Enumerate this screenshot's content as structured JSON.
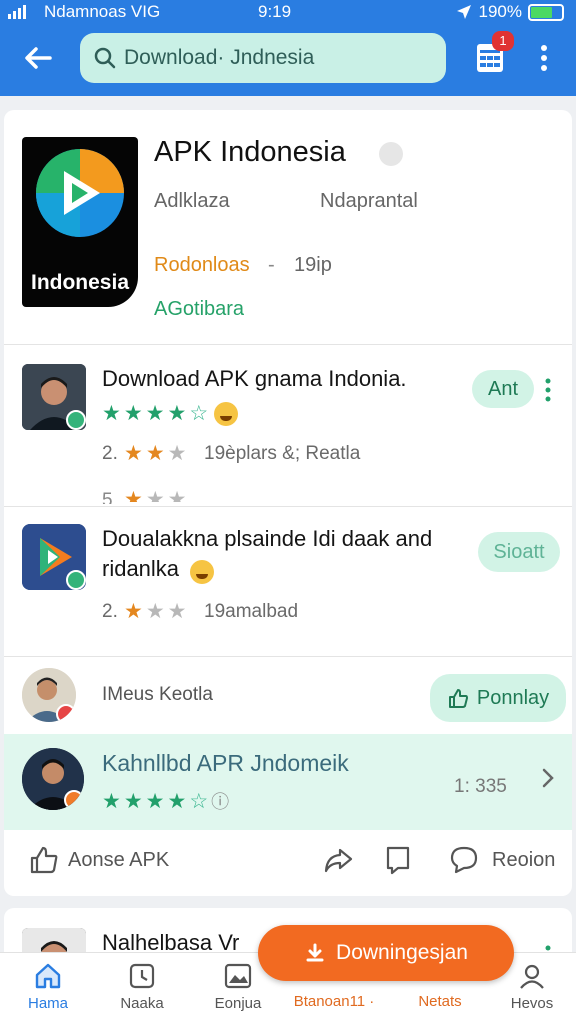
{
  "status_bar": {
    "carrier": "Ndamnoas VIG",
    "time": "9:19",
    "battery": "190%"
  },
  "search": {
    "value": "Download· Jndnesia",
    "placeholder": "Download· Jndnesia"
  },
  "header": {
    "notification_count": "1"
  },
  "app": {
    "title": "APK Indonesia",
    "logo_text": "Indonesia",
    "developer": "Adlklaza",
    "category": "Ndaprantal",
    "downloads": "Rodonloas",
    "separator": "-",
    "size": "19ip",
    "status": "AGotibara"
  },
  "list": [
    {
      "title": "Download APK gnama Indonia.",
      "rating_filled": 4,
      "rating_half": true,
      "sub_prefix": "2.",
      "sub_stars_filled": 2,
      "sub_stars_total": 3,
      "sub_text": "19èplars &; Reatla",
      "extra_prefix": "5",
      "action": "Ant"
    },
    {
      "title": "Doualakkna plsainde Idi daak and ridanlka",
      "sub_prefix": "2.",
      "sub_stars_filled": 1,
      "sub_stars_total": 3,
      "sub_text": "19amalbad",
      "action": "Sioatt"
    }
  ],
  "user_row": {
    "name": "IMeus Keotla",
    "button": "Ponnlay"
  },
  "featured": {
    "title": "Kahnllbd APR Jndomeik",
    "rating_filled": 4,
    "count": "1: 335"
  },
  "actions": {
    "like": "Aonse APK",
    "report": "Reoion"
  },
  "next_card": {
    "title": "Nalhelbasa Vr"
  },
  "fab": {
    "label": "Downingesjan"
  },
  "bottom_nav": [
    {
      "label": "Hama",
      "active": true
    },
    {
      "label": "Naaka",
      "active": false
    },
    {
      "label": "Eonjua",
      "active": false
    },
    {
      "label": "Btanoan11 ·",
      "active": false
    },
    {
      "label": "Netats",
      "active": false
    },
    {
      "label": "Hevos",
      "active": false
    }
  ],
  "colors": {
    "primary": "#2a7de1",
    "accent": "#f26a21",
    "green": "#22a06b",
    "mint": "#d2f3e6"
  }
}
